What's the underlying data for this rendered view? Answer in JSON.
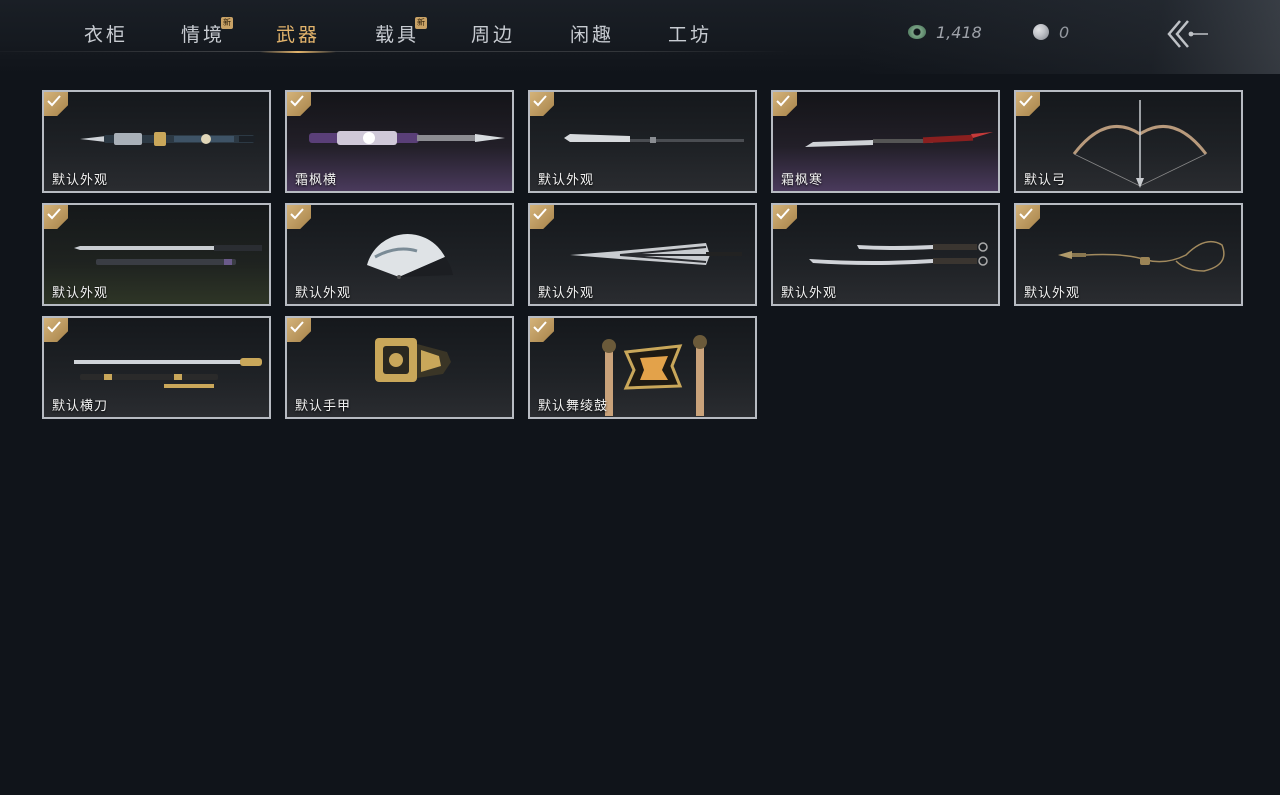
{
  "tabs": [
    {
      "label": "衣柜",
      "new": false
    },
    {
      "label": "情境",
      "new": true
    },
    {
      "label": "武器",
      "new": false
    },
    {
      "label": "载具",
      "new": true
    },
    {
      "label": "周边",
      "new": false
    },
    {
      "label": "闲趣",
      "new": false
    },
    {
      "label": "工坊",
      "new": false
    }
  ],
  "active_tab": "武器",
  "new_badge": "新",
  "currency": {
    "jade": {
      "icon": "jade-coin-icon",
      "amount": "1,418"
    },
    "pearl": {
      "icon": "pearl-icon",
      "amount": "0"
    }
  },
  "items": [
    {
      "label": "默认外观",
      "weapon": "ornate-spear",
      "checked": true
    },
    {
      "label": "霜枫横",
      "weapon": "purple-spear",
      "checked": true
    },
    {
      "label": "默认外观",
      "weapon": "long-blade",
      "checked": true
    },
    {
      "label": "霜枫寒",
      "weapon": "red-glaive",
      "checked": true
    },
    {
      "label": "默认弓",
      "weapon": "bow",
      "checked": true
    },
    {
      "label": "默认外观",
      "weapon": "sword-and-scabbard",
      "checked": true
    },
    {
      "label": "默认外观",
      "weapon": "folding-fan",
      "checked": true
    },
    {
      "label": "默认外观",
      "weapon": "umbrella",
      "checked": true
    },
    {
      "label": "默认外观",
      "weapon": "twin-sabers",
      "checked": true
    },
    {
      "label": "默认外观",
      "weapon": "rope-dart",
      "checked": true
    },
    {
      "label": "默认横刀",
      "weapon": "hengdao-saber",
      "checked": true
    },
    {
      "label": "默认手甲",
      "weapon": "gauntlet",
      "checked": true
    },
    {
      "label": "默认舞绫鼓",
      "weapon": "drum-and-sticks",
      "checked": true
    }
  ],
  "colors": {
    "accent": "#e3b46c",
    "check": "#c9a266",
    "background": "#10141a"
  }
}
